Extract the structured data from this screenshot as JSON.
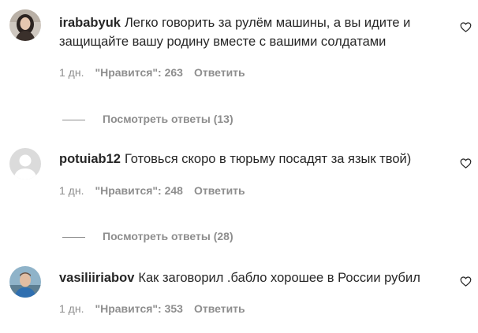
{
  "comments": [
    {
      "username": "irababyuk",
      "text": "Легко говорить за рулём машины, а вы идите и защищайте вашу родину вместе с вашими солдатами",
      "time": "1 дн.",
      "likes": "\"Нравится\": 263",
      "reply": "Ответить",
      "view_replies": "Посмотреть ответы (13)",
      "avatar": "user-photo"
    },
    {
      "username": "potuiab12",
      "text": "Готовься скоро в тюрьму посадят за язык твой)",
      "time": "1 дн.",
      "likes": "\"Нравится\": 248",
      "reply": "Ответить",
      "view_replies": "Посмотреть ответы (28)",
      "avatar": "default-user"
    },
    {
      "username": "vasiliiriabov",
      "text": "Как заговорил .бабло хорошее в России рубил",
      "time": "1 дн.",
      "likes": "\"Нравится\": 353",
      "reply": "Ответить",
      "avatar": "user-photo"
    }
  ],
  "icons": {
    "like": "heart-outline-icon"
  },
  "colors": {
    "text": "#262626",
    "secondary": "#8e8e8e"
  }
}
